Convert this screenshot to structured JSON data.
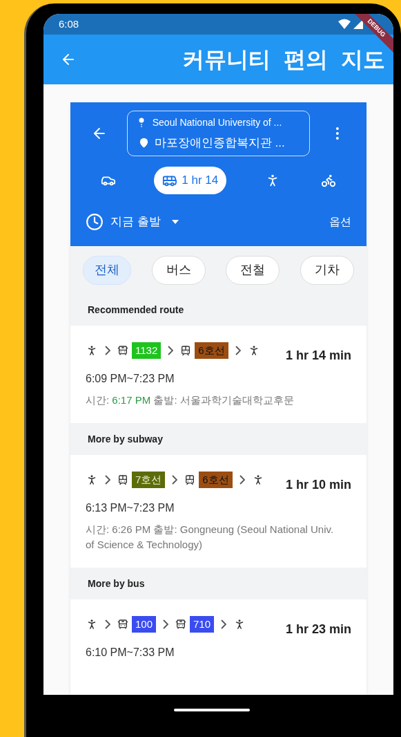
{
  "status_bar": {
    "time": "6:08"
  },
  "debug_banner": "DEBUG",
  "app_bar": {
    "title": "커뮤니티 편의 지도"
  },
  "directions": {
    "origin": "Seoul National University of ...",
    "destination": "마포장애인종합복지관 ...",
    "modes": [
      {
        "kind": "car",
        "selected": false
      },
      {
        "kind": "transit",
        "selected": true,
        "label": "1 hr 14"
      },
      {
        "kind": "walk",
        "selected": false
      },
      {
        "kind": "bike",
        "selected": false
      }
    ],
    "departure": "지금 출발",
    "options": "옵션"
  },
  "filters": [
    {
      "label": "전체",
      "selected": true
    },
    {
      "label": "버스",
      "selected": false
    },
    {
      "label": "전철",
      "selected": false
    },
    {
      "label": "기차",
      "selected": false
    }
  ],
  "routes": [
    {
      "section": "Recommended route",
      "duration": "1 hr 14 min",
      "times": "6:09 PM~7:23 PM",
      "detail": {
        "label": "시간:",
        "time": "6:17 PM",
        "live": true,
        "rest": "출발: 서울과학기술대학교후문"
      },
      "steps": [
        {
          "kind": "walk"
        },
        {
          "kind": "bus",
          "label": "1132",
          "color": "#1ec31e"
        },
        {
          "kind": "subway",
          "label": "6호선",
          "color": "#9c4e12"
        },
        {
          "kind": "walk"
        }
      ]
    },
    {
      "section": "More by subway",
      "duration": "1 hr 10 min",
      "times": "6:13 PM~7:23 PM",
      "detail": {
        "label": "시간:",
        "time": "6:26 PM",
        "live": false,
        "rest": "출발: Gongneung (Seoul National Univ. of Science & Technology)"
      },
      "steps": [
        {
          "kind": "walk"
        },
        {
          "kind": "subway",
          "label": "7호선",
          "color": "#5b6c08"
        },
        {
          "kind": "subway",
          "label": "6호선",
          "color": "#9c4e12"
        },
        {
          "kind": "walk"
        }
      ]
    },
    {
      "section": "More by bus",
      "duration": "1 hr 23 min",
      "times": "6:10 PM~7:33 PM",
      "steps": [
        {
          "kind": "walk"
        },
        {
          "kind": "bus",
          "label": "100",
          "color": "#3a4cf0"
        },
        {
          "kind": "bus",
          "label": "710",
          "color": "#3a4cf0"
        },
        {
          "kind": "walk"
        }
      ]
    }
  ]
}
